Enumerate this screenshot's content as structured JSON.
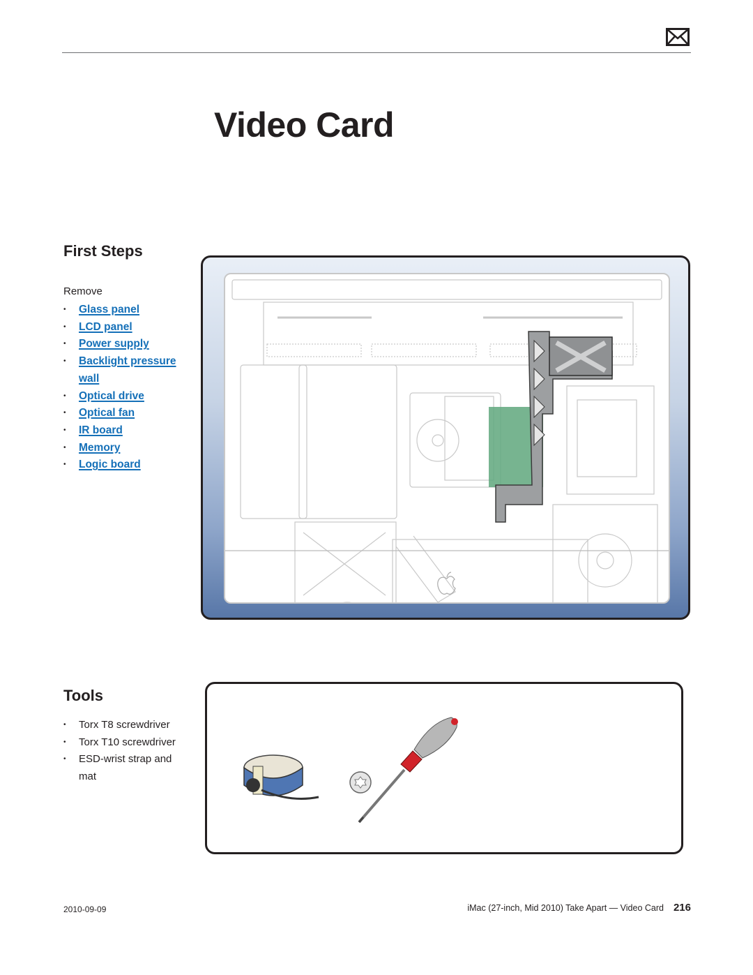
{
  "header": {
    "icon": "mail-icon"
  },
  "title": "Video Card",
  "first_steps": {
    "heading": "First Steps",
    "intro": "Remove",
    "links": [
      {
        "label": "Glass panel"
      },
      {
        "label": "LCD panel"
      },
      {
        "label": "Power supply"
      },
      {
        "label": "Backlight pressure wall"
      },
      {
        "label": "Optical drive"
      },
      {
        "label": "Optical fan"
      },
      {
        "label": "IR board"
      },
      {
        "label": "Memory"
      },
      {
        "label": "Logic board"
      }
    ],
    "figure": {
      "description": "iMac internal layout with video card and bracket highlighted",
      "highlight_color": "#5fa77c",
      "frame_gradient": [
        "#e9eff7",
        "#5877a8"
      ]
    }
  },
  "tools": {
    "heading": "Tools",
    "items": [
      "Torx T8 screwdriver",
      "Torx T10 screwdriver",
      "ESD-wrist strap and mat"
    ],
    "figure": {
      "description": "ESD wrist strap, Torx screw head, and Torx screwdriver",
      "icons": [
        "wrist-strap-icon",
        "torx-screw-icon",
        "screwdriver-icon"
      ]
    }
  },
  "footer": {
    "date": "2010-09-09",
    "doc_title": "iMac (27-inch, Mid 2010) Take Apart — Video Card",
    "page_number": "216"
  }
}
